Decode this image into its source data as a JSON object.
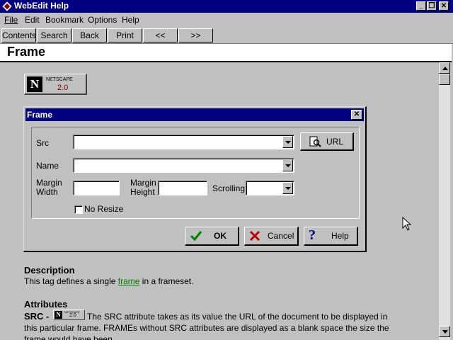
{
  "window": {
    "title": "WebEdit Help"
  },
  "menu": [
    "File",
    "Edit",
    "Bookmark",
    "Options",
    "Help"
  ],
  "buttons": [
    "Contents",
    "Search",
    "Back",
    "Print",
    "<<",
    ">>"
  ],
  "topic": {
    "title": "Frame"
  },
  "badge": {
    "word": "NETSCAPE",
    "version": "2.0",
    "letter": "N"
  },
  "dialog": {
    "title": "Frame",
    "src_label": "Src",
    "url_button": "URL",
    "name_label": "Name",
    "margin_width_label_1": "Margin",
    "margin_width_label_2": "Width",
    "margin_height_label_1": "Margin",
    "margin_height_label_2": "Height",
    "scrolling_label": "Scrolling",
    "no_resize_label": "No Resize",
    "ok": "OK",
    "cancel": "Cancel",
    "help": "Help"
  },
  "description": {
    "heading": "Description",
    "before": "This tag defines a single ",
    "link": "frame",
    "after": " in a frameset."
  },
  "attributes": {
    "heading": "Attributes",
    "src_term": "SRC -",
    "line1": "The SRC attribute takes as its value the URL of the document to be displayed in",
    "line2": "this particular frame. FRAMEs without SRC attributes are displayed as a blank space the size the",
    "line3": "frame would have been."
  }
}
